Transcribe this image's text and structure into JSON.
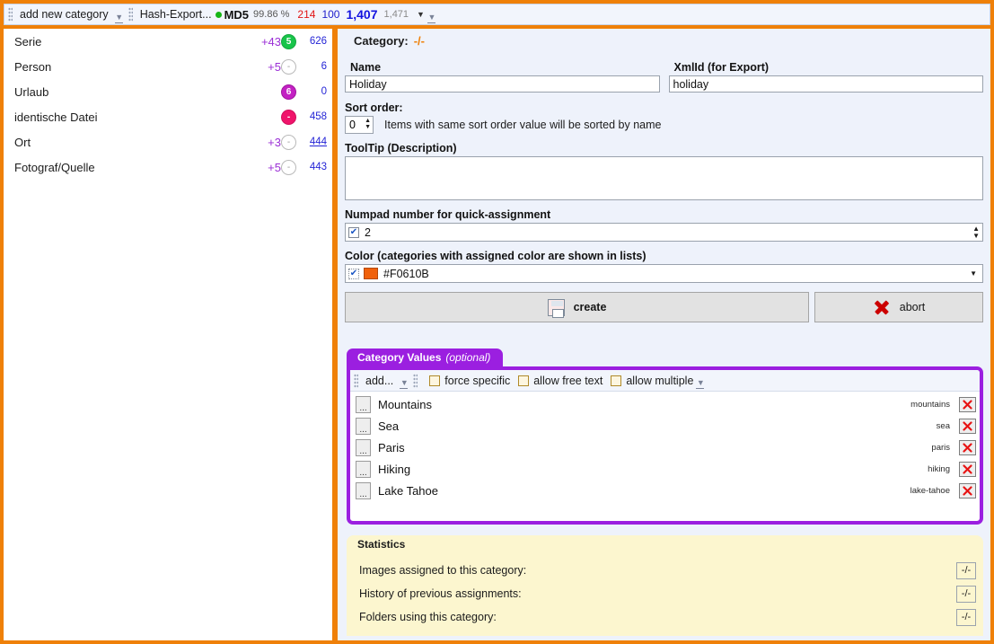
{
  "toolbar": {
    "add_new_category": "add new category",
    "hash_export": "Hash-Export...",
    "hash_name": "MD5",
    "percent": "99.86 %",
    "count_red": "214",
    "count_blue": "100",
    "count_big": "1,407",
    "count_gray": "1,471"
  },
  "sidebar": {
    "items": [
      {
        "label": "Serie",
        "plus": "+43",
        "badge": "5",
        "badge_style": "green",
        "count": "626",
        "underline": false
      },
      {
        "label": "Person",
        "plus": "+5",
        "badge": "-",
        "badge_style": "empty",
        "count": "6",
        "underline": false
      },
      {
        "label": "Urlaub",
        "plus": "",
        "badge": "6",
        "badge_style": "magenta",
        "count": "0",
        "underline": false
      },
      {
        "label": "identische Datei",
        "plus": "",
        "badge": "-",
        "badge_style": "pink",
        "count": "458",
        "underline": false
      },
      {
        "label": "Ort",
        "plus": "+3",
        "badge": "-",
        "badge_style": "empty",
        "count": "444",
        "underline": true
      },
      {
        "label": "Fotograf/Quelle",
        "plus": "+5",
        "badge": "-",
        "badge_style": "empty",
        "count": "443",
        "underline": false
      }
    ]
  },
  "detail": {
    "tab_label": "Category:",
    "tab_value": "-/-",
    "name_label": "Name",
    "name_value": "Holiday",
    "xmlid_label": "XmlId (for Export)",
    "xmlid_value": "holiday",
    "sort_label": "Sort order:",
    "sort_value": "0",
    "sort_hint": "Items with same sort order value will be sorted by name",
    "tooltip_label": "ToolTip (Description)",
    "tooltip_value": "",
    "numpad_label": "Numpad number for quick-assignment",
    "numpad_value": "2",
    "color_label": "Color (categories with assigned color are shown in lists)",
    "color_value": "#F0610B",
    "color_hex": "#F0610B",
    "create_label": "create",
    "abort_label": "abort"
  },
  "category_values": {
    "panel_title": "Category Values",
    "panel_title_optional": "(optional)",
    "add_label": "add...",
    "force_specific_label": "force specific",
    "allow_free_text_label": "allow free text",
    "allow_multiple_label": "allow multiple",
    "rows": [
      {
        "name": "Mountains",
        "xmlid": "mountains"
      },
      {
        "name": "Sea",
        "xmlid": "sea"
      },
      {
        "name": "Paris",
        "xmlid": "paris"
      },
      {
        "name": "Hiking",
        "xmlid": "hiking"
      },
      {
        "name": "Lake Tahoe",
        "xmlid": "lake-tahoe"
      }
    ]
  },
  "statistics": {
    "title": "Statistics",
    "rows": [
      {
        "label": "Images assigned to this category:",
        "value": "-/-"
      },
      {
        "label": "History of previous assignments:",
        "value": "-/-"
      },
      {
        "label": "Folders using this category:",
        "value": "-/-"
      }
    ]
  },
  "colors": {
    "frame": "#ef8008",
    "accent_purple": "#9b1fe0",
    "accent_orange": "#ef8008"
  }
}
